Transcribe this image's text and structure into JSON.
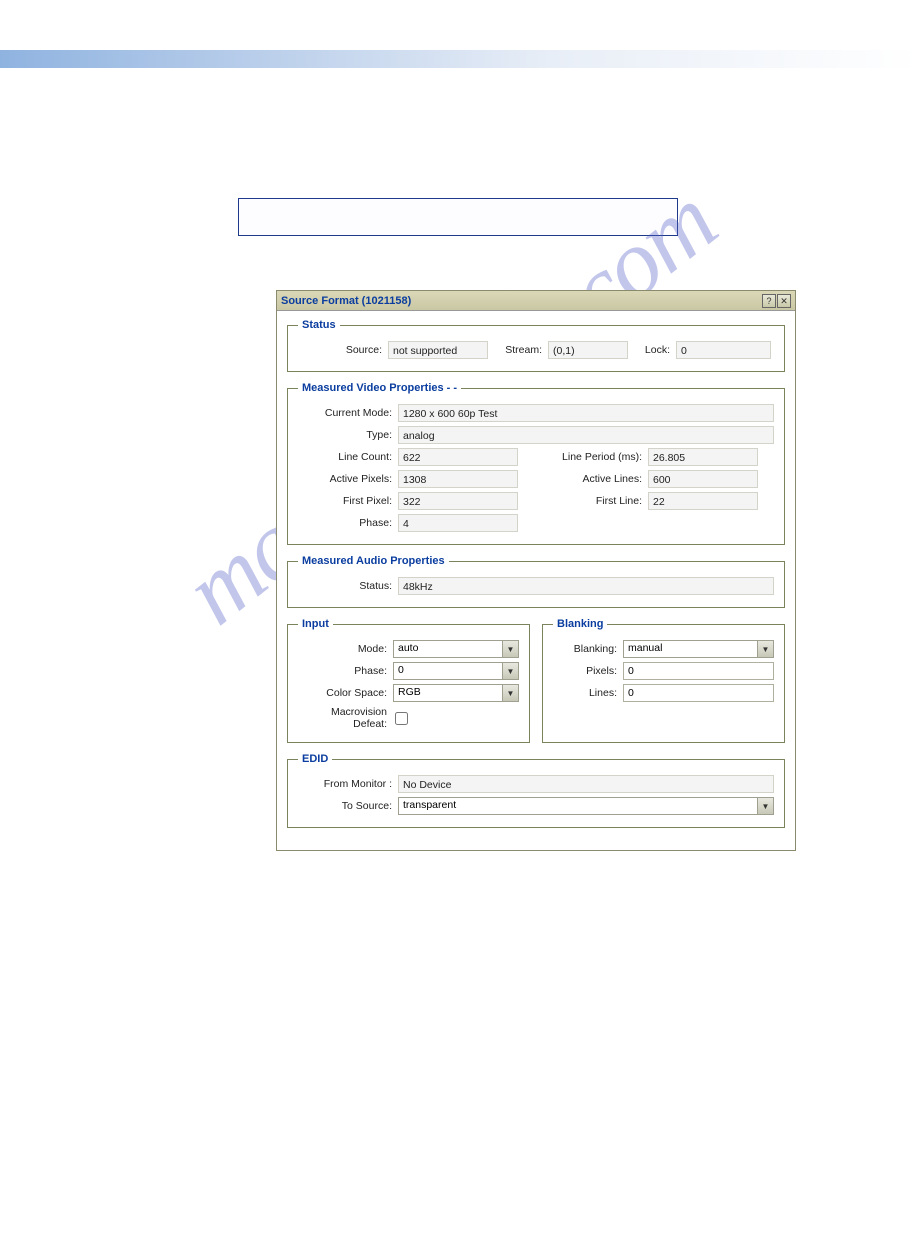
{
  "watermark": "manualshive.com",
  "dialog": {
    "title": "Source Format (1021158)"
  },
  "status": {
    "legend": "Status",
    "source_label": "Source:",
    "source_value": "not supported",
    "stream_label": "Stream:",
    "stream_value": "(0,1)",
    "lock_label": "Lock:",
    "lock_value": "0"
  },
  "video": {
    "legend": "Measured Video Properties  -  -",
    "current_mode_label": "Current Mode:",
    "current_mode_value": "1280 x 600 60p Test",
    "type_label": "Type:",
    "type_value": "analog",
    "line_count_label": "Line Count:",
    "line_count_value": "622",
    "line_period_label": "Line Period (ms):",
    "line_period_value": "26.805",
    "active_pixels_label": "Active Pixels:",
    "active_pixels_value": "1308",
    "active_lines_label": "Active Lines:",
    "active_lines_value": "600",
    "first_pixel_label": "First Pixel:",
    "first_pixel_value": "322",
    "first_line_label": "First Line:",
    "first_line_value": "22",
    "phase_label": "Phase:",
    "phase_value": "4"
  },
  "audio": {
    "legend": "Measured Audio Properties",
    "status_label": "Status:",
    "status_value": "48kHz"
  },
  "input": {
    "legend": "Input",
    "mode_label": "Mode:",
    "mode_value": "auto",
    "phase_label": "Phase:",
    "phase_value": "0",
    "color_space_label": "Color Space:",
    "color_space_value": "RGB",
    "macrovision_label": "Macrovision Defeat:"
  },
  "blanking": {
    "legend": "Blanking",
    "blanking_label": "Blanking:",
    "blanking_value": "manual",
    "pixels_label": "Pixels:",
    "pixels_value": "0",
    "lines_label": "Lines:",
    "lines_value": "0"
  },
  "edid": {
    "legend": "EDID",
    "from_monitor_label": "From Monitor :",
    "from_monitor_value": "No Device",
    "to_source_label": "To Source:",
    "to_source_value": "transparent"
  }
}
